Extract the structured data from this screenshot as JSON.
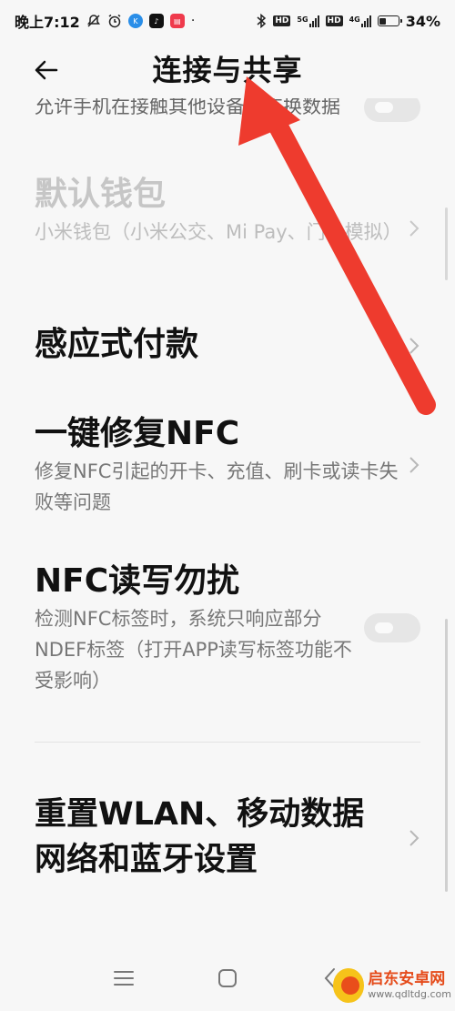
{
  "status_bar": {
    "time": "晚上7:12",
    "apps": [
      "K",
      "抖音",
      "小红书"
    ],
    "hd_badge": "HD",
    "net_5g": "5G",
    "net_4g": "4G",
    "battery": "34%"
  },
  "header": {
    "title": "连接与共享"
  },
  "settings": {
    "partial_item": {
      "subtitle": "允许手机在接触其他设备时交换数据"
    },
    "default_wallet": {
      "title": "默认钱包",
      "subtitle": "小米钱包（小米公交、Mi Pay、门卡模拟）"
    },
    "tap_to_pay": {
      "title": "感应式付款"
    },
    "repair_nfc": {
      "title": "一键修复NFC",
      "subtitle": "修复NFC引起的开卡、充值、刷卡或读卡失败等问题"
    },
    "nfc_dnd": {
      "title": "NFC读写勿扰",
      "subtitle": "检测NFC标签时，系统只响应部分NDEF标签（打开APP读写标签功能不受影响）"
    },
    "reset_network": {
      "title": "重置WLAN、移动数据网络和蓝牙设置"
    }
  },
  "watermark": {
    "name": "启东安卓网",
    "url": "www.qdltdg.com"
  },
  "colors": {
    "arrow": "#ee3b2e",
    "background": "#f7f7f7"
  },
  "icons": [
    "back-arrow-icon",
    "chevron-right-icon",
    "menu-icon",
    "home-icon",
    "back-icon"
  ]
}
